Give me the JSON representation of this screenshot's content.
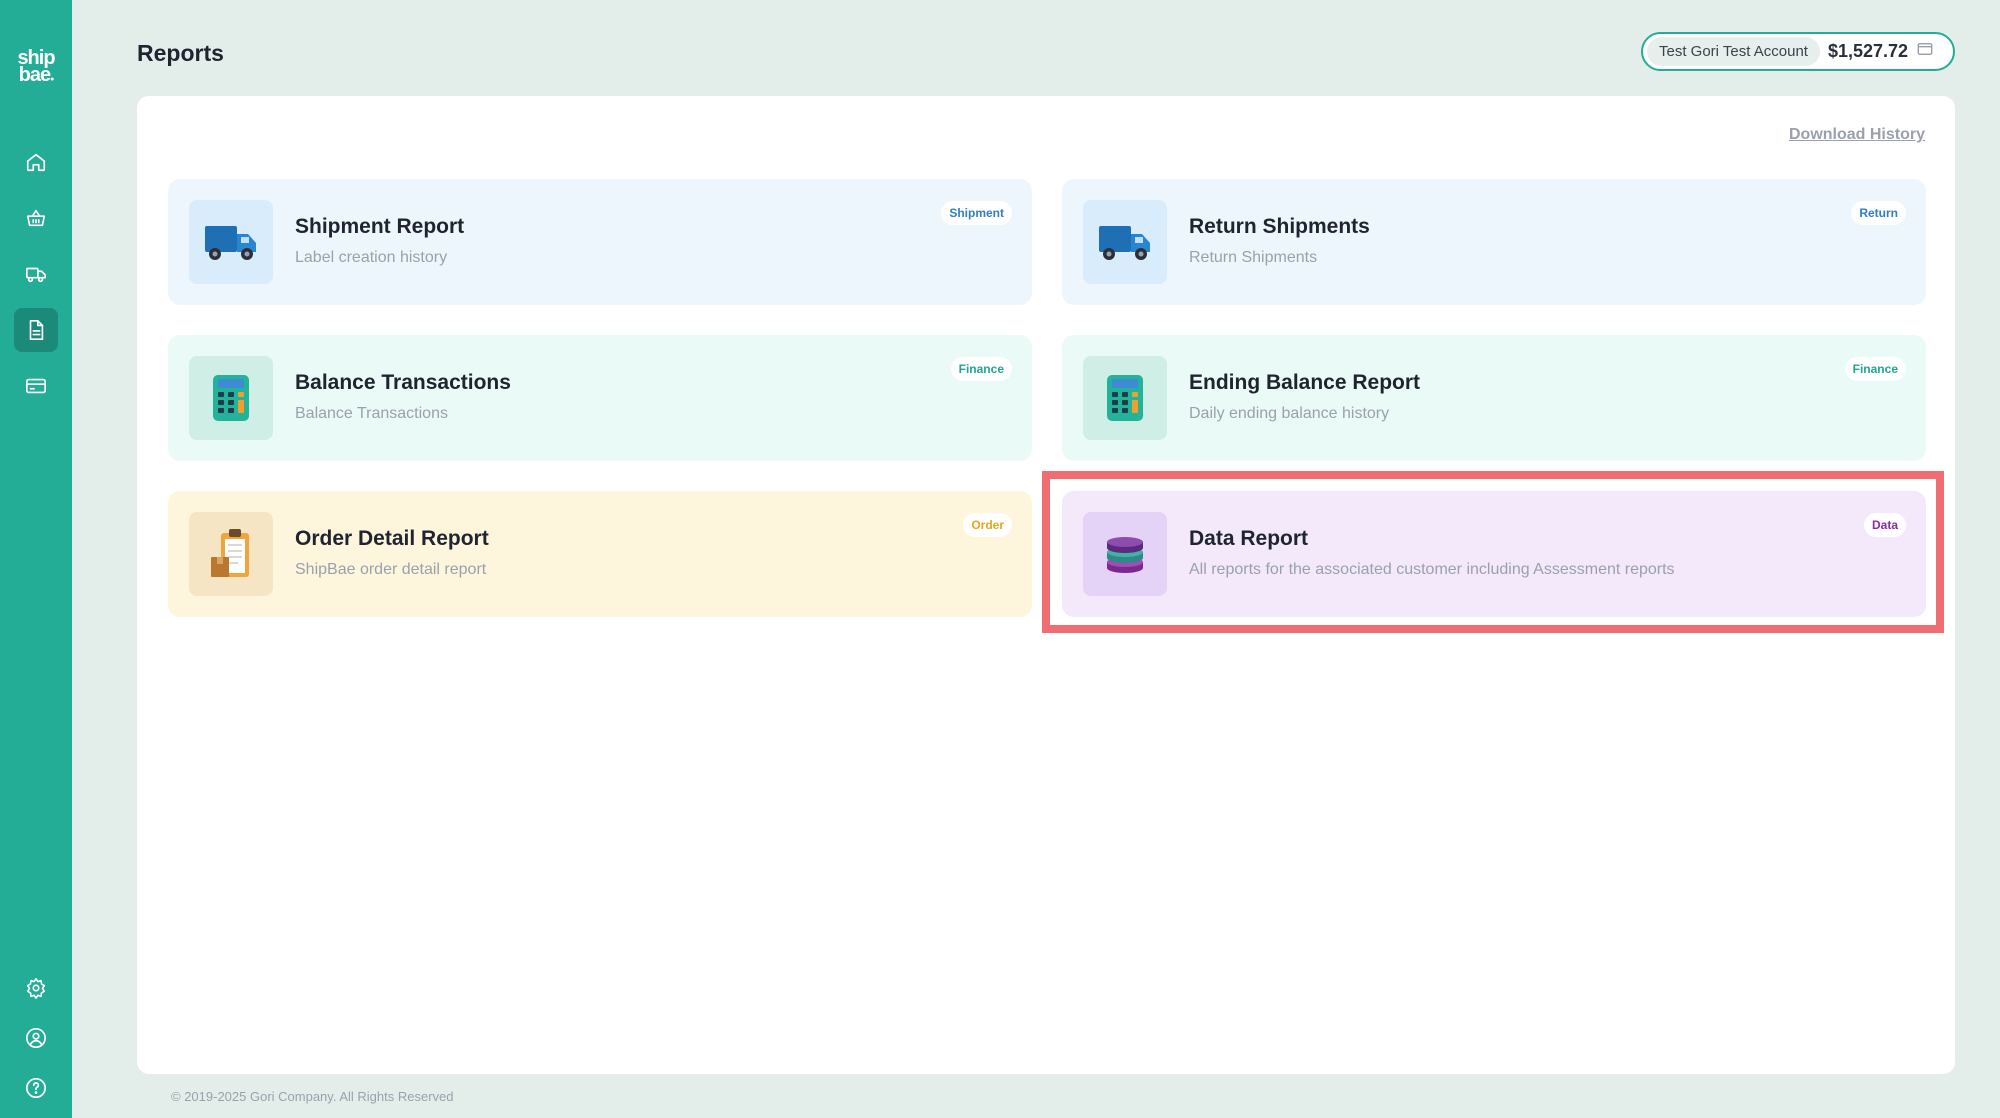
{
  "sidebar": {
    "logo_top": "ship",
    "logo_bottom": "bae",
    "nav": [
      {
        "icon": "home-icon"
      },
      {
        "icon": "basket-icon"
      },
      {
        "icon": "truck-icon"
      },
      {
        "icon": "report-icon",
        "active": true
      },
      {
        "icon": "card-icon"
      }
    ],
    "bottom": [
      {
        "icon": "gear-icon"
      },
      {
        "icon": "user-circle-icon"
      },
      {
        "icon": "help-icon"
      }
    ]
  },
  "header": {
    "title": "Reports",
    "account_name": "Test Gori Test Account",
    "balance": "$1,527.72"
  },
  "main": {
    "download_history": "Download History",
    "cards": [
      {
        "title": "Shipment Report",
        "subtitle": "Label creation history",
        "badge": "Shipment",
        "icon": "truck-icon"
      },
      {
        "title": "Return Shipments",
        "subtitle": "Return Shipments",
        "badge": "Return",
        "icon": "truck-icon"
      },
      {
        "title": "Balance Transactions",
        "subtitle": "Balance Transactions",
        "badge": "Finance",
        "icon": "calculator-icon"
      },
      {
        "title": "Ending Balance Report",
        "subtitle": "Daily ending balance history",
        "badge": "Finance",
        "icon": "calculator-icon"
      },
      {
        "title": "Order Detail Report",
        "subtitle": "ShipBae order detail report",
        "badge": "Order",
        "icon": "clipboard-icon"
      },
      {
        "title": "Data Report",
        "subtitle": "All reports for the associated customer including Assessment reports",
        "badge": "Data",
        "icon": "database-icon",
        "highlighted": true
      }
    ]
  },
  "footer": {
    "copyright": "© 2019-2025 Gori Company. All Rights Reserved"
  },
  "colors": {
    "sidebar": "#24ad96",
    "highlight": "#f06d72"
  }
}
